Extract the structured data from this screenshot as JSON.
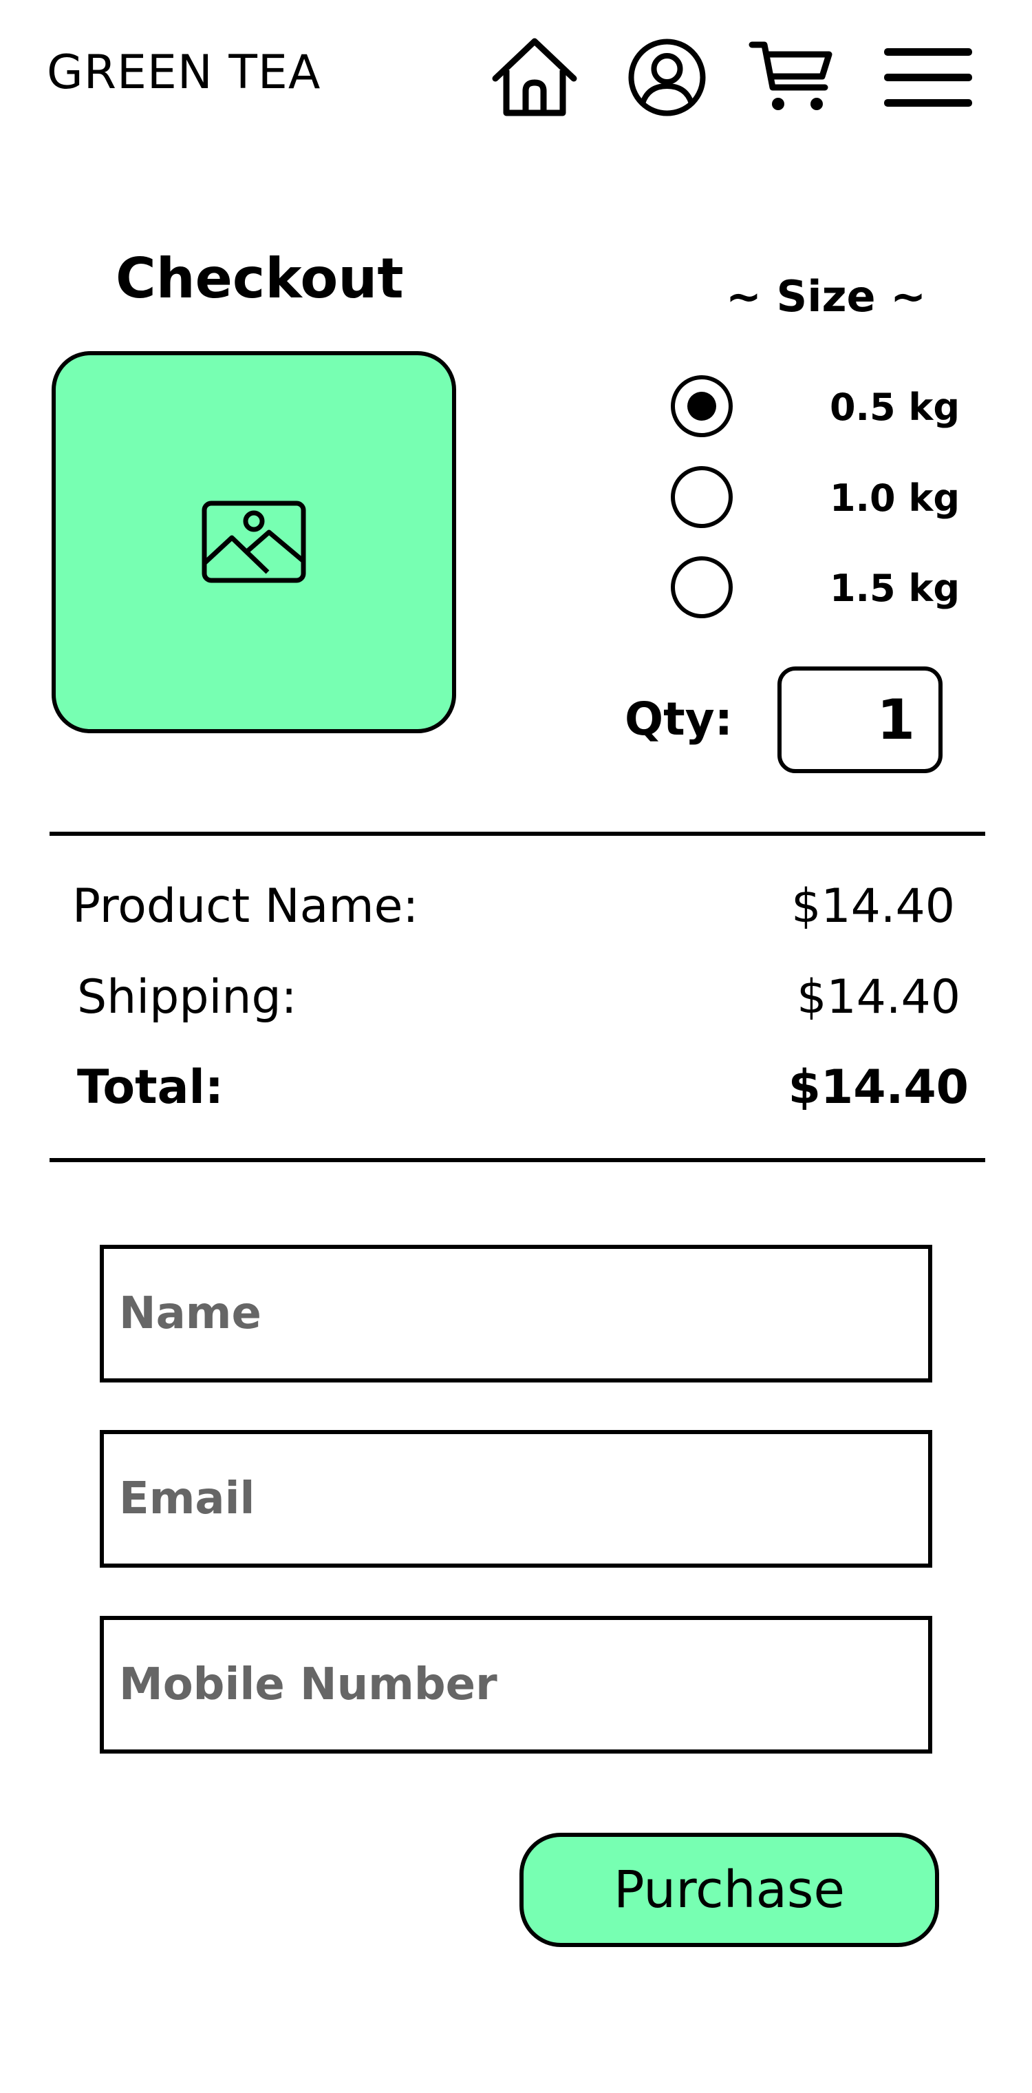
{
  "colors": {
    "accent": "#77ffb2"
  },
  "header": {
    "brand": "GREEN TEA",
    "icons": [
      "home-icon",
      "account-icon",
      "cart-icon",
      "menu-icon"
    ]
  },
  "product": {
    "title": "Checkout",
    "image_icon": "image-placeholder-icon"
  },
  "size": {
    "heading": "~ Size ~",
    "options": [
      {
        "label": "0.5 kg",
        "selected": true
      },
      {
        "label": "1.0 kg",
        "selected": false
      },
      {
        "label": "1.5 kg",
        "selected": false
      }
    ]
  },
  "quantity": {
    "label": "Qty:",
    "value": "1"
  },
  "summary": {
    "product": {
      "label": "Product Name:",
      "value": "$14.40"
    },
    "shipping": {
      "label": "Shipping:",
      "value": "$14.40"
    },
    "total": {
      "label": "Total:",
      "value": "$14.40"
    }
  },
  "form": {
    "name_placeholder": "Name",
    "email_placeholder": "Email",
    "mobile_placeholder": "Mobile Number"
  },
  "purchase_label": "Purchase"
}
